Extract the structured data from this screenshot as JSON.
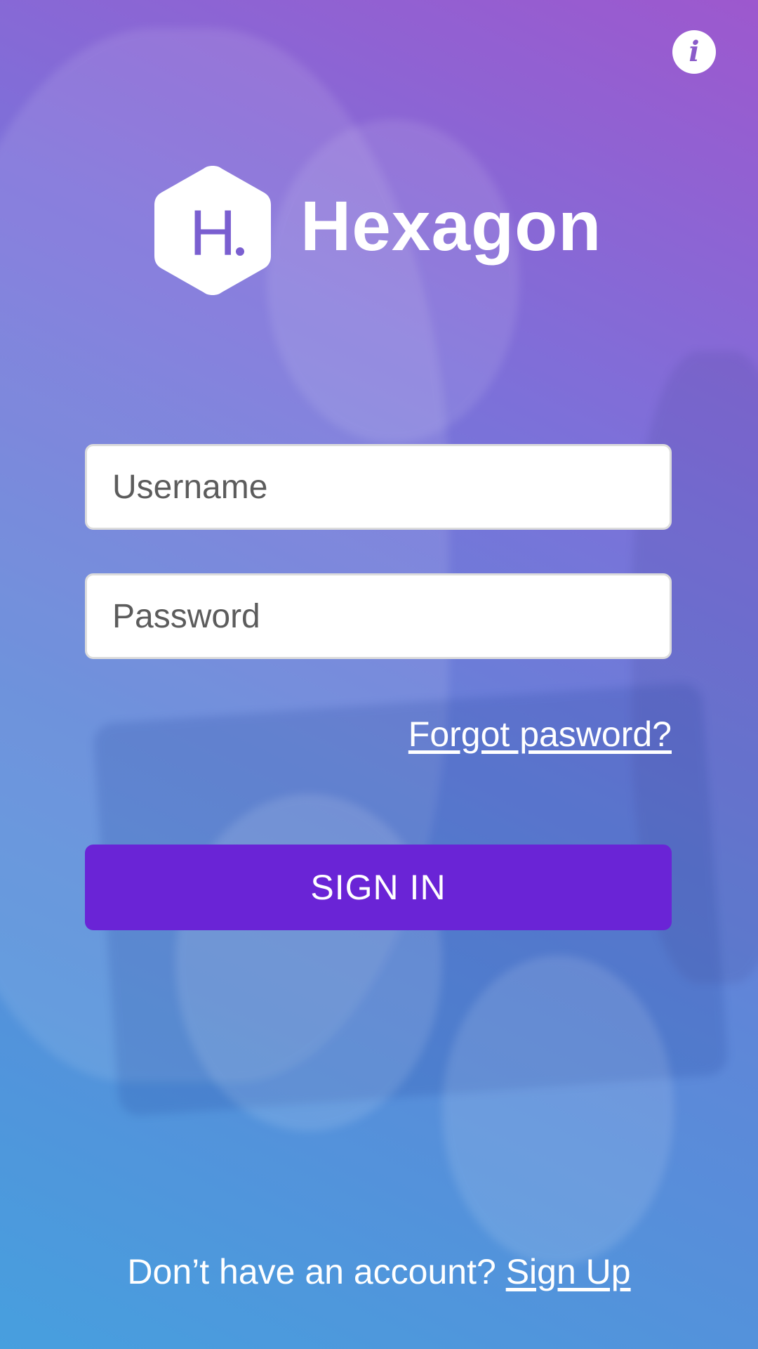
{
  "header": {
    "info_icon": "info-icon",
    "info_glyph": "i"
  },
  "logo": {
    "letter": "H",
    "name": "Hexagon"
  },
  "form": {
    "username_placeholder": "Username",
    "password_placeholder": "Password",
    "forgot_label": "Forgot pasword?",
    "signin_label": "SIGN IN"
  },
  "footer": {
    "prompt": "Don’t have an account?",
    "signup_label": "Sign Up"
  },
  "colors": {
    "accent": "#6a24d6",
    "gradient_top": "#9d58ce",
    "gradient_bottom": "#479fde",
    "logo_mark": "#7a5fd0"
  }
}
